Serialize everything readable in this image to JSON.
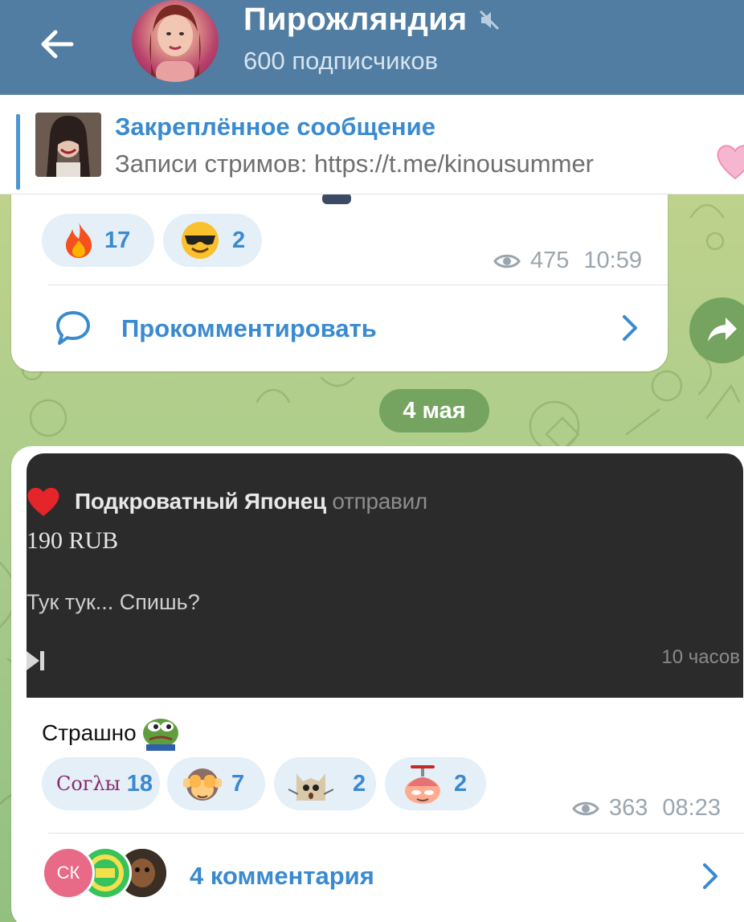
{
  "header": {
    "title": "Пирожляндия",
    "subscribers": "600 подписчиков"
  },
  "pinned": {
    "title": "Закреплённое сообщение",
    "text": "Записи стримов:  https://t.me/kinousummer"
  },
  "message1": {
    "reactions": [
      {
        "icon": "fire-icon",
        "count": "17"
      },
      {
        "icon": "sunglasses-smiley-icon",
        "count": "2"
      }
    ],
    "views": "475",
    "time": "10:59",
    "comment_label": "Прокомментировать"
  },
  "date_separator": "4 мая",
  "message2": {
    "screenshot": {
      "sender": "Подкроватный Японец",
      "sent_word": "отправил",
      "amount": "190 RUB",
      "text": "Тук тук... Спишь?",
      "time": "10 часов"
    },
    "caption": "Страшно",
    "reactions": [
      {
        "icon": "sogly-sticker-icon",
        "label": "Согλы",
        "count": "18"
      },
      {
        "icon": "see-no-evil-monkey-icon",
        "count": "7"
      },
      {
        "icon": "cat-meme-icon",
        "count": "2"
      },
      {
        "icon": "propeller-hat-emoji-icon",
        "count": "2"
      }
    ],
    "views": "363",
    "time": "08:23",
    "comments": "4 комментария",
    "commenter_initials": "СК"
  },
  "colors": {
    "header": "#517da2",
    "accent": "#3a8ad0",
    "date_pill": "#74a460",
    "reaction_bg": "#e4eff8"
  }
}
